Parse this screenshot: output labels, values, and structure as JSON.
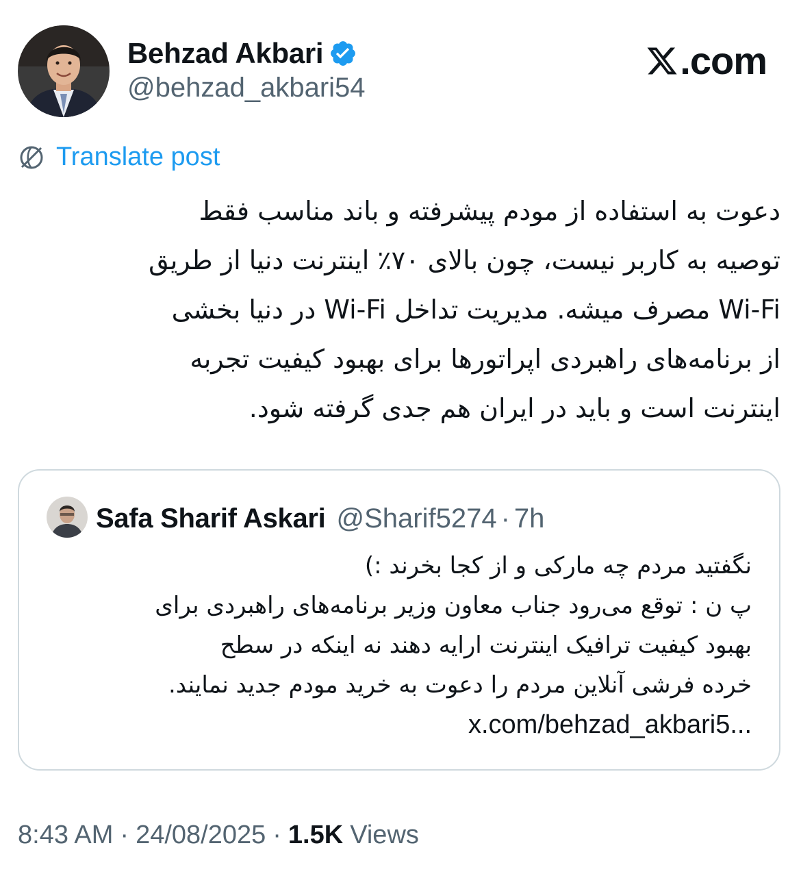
{
  "header": {
    "author_name": "Behzad Akbari",
    "author_handle": "@behzad_akbari54",
    "verified_icon": "verified-badge-icon",
    "brand_text": ".com",
    "brand_icon": "x-logo-icon"
  },
  "translate": {
    "label": "Translate post",
    "icon": "globe-icon",
    "color": "#1d9bf0"
  },
  "post": {
    "lines": [
      "دعوت به استفاده از مودم پیشرفته و باند مناسب فقط",
      "توصیه به کاربر نیست، چون بالای ۷۰٪ اینترنت دنیا از طریق",
      "Wi-Fi مصرف میشه. مدیریت تداخل Wi-Fi در دنیا بخشی",
      "از برنامه‌های راهبردی اپراتورها برای بهبود کیفیت تجربه",
      "اینترنت است و باید در ایران هم جدی گرفته شود."
    ]
  },
  "quote": {
    "author_name": "Safa Sharif Askari",
    "author_handle": "@Sharif5274",
    "separator": "·",
    "time": "7h",
    "lines": [
      "نگفتید مردم چه مارکی و از کجا بخرند :)",
      "پ ن : توقع می‌رود جناب معاون وزیر برنامه‌های راهبردی برای",
      "بهبود کیفیت ترافیک اینترنت ارایه دهند نه اینکه در سطح",
      "خرده فرشی آنلاین مردم را دعوت به خرید مودم جدید نمایند."
    ],
    "link": "x.com/behzad_akbari5..."
  },
  "footer": {
    "time": "8:43 AM",
    "separator": "·",
    "date": "24/08/2025",
    "views_count": "1.5K",
    "views_label": "Views"
  },
  "colors": {
    "text": "#0f1419",
    "secondary": "#536471",
    "accent": "#1d9bf0",
    "border": "#cfd9de"
  }
}
